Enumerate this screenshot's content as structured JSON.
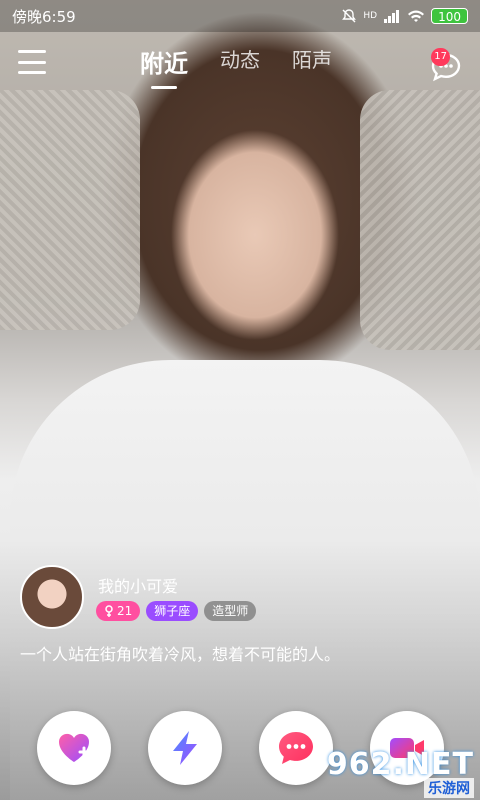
{
  "status_bar": {
    "time": "傍晚6:59",
    "network": "HD",
    "battery": "100"
  },
  "nav": {
    "tabs": [
      {
        "label": "附近",
        "active": true
      },
      {
        "label": "动态",
        "active": false
      },
      {
        "label": "陌声",
        "active": false
      }
    ],
    "message_badge": "17"
  },
  "profile": {
    "name": "我的小可爱",
    "age": "21",
    "zodiac": "狮子座",
    "job": "造型师",
    "bio": "一个人站在街角吹着冷风，想着不可能的人。"
  },
  "actions": [
    {
      "icon": "heart-plus-icon"
    },
    {
      "icon": "lightning-icon"
    },
    {
      "icon": "chat-bubble-icon"
    },
    {
      "icon": "video-camera-icon"
    }
  ],
  "watermark": {
    "logo": "962.NET",
    "sub": "乐游网"
  },
  "colors": {
    "age_tag": "#ff4fa0",
    "zodiac_tag": "#9a4dff",
    "job_tag": "#787878",
    "badge": "#ff3a5c",
    "heart": "#b35bff",
    "lightning": "#7d5bff",
    "chat": "#ff3a6b",
    "video": "#ff3a6b"
  }
}
